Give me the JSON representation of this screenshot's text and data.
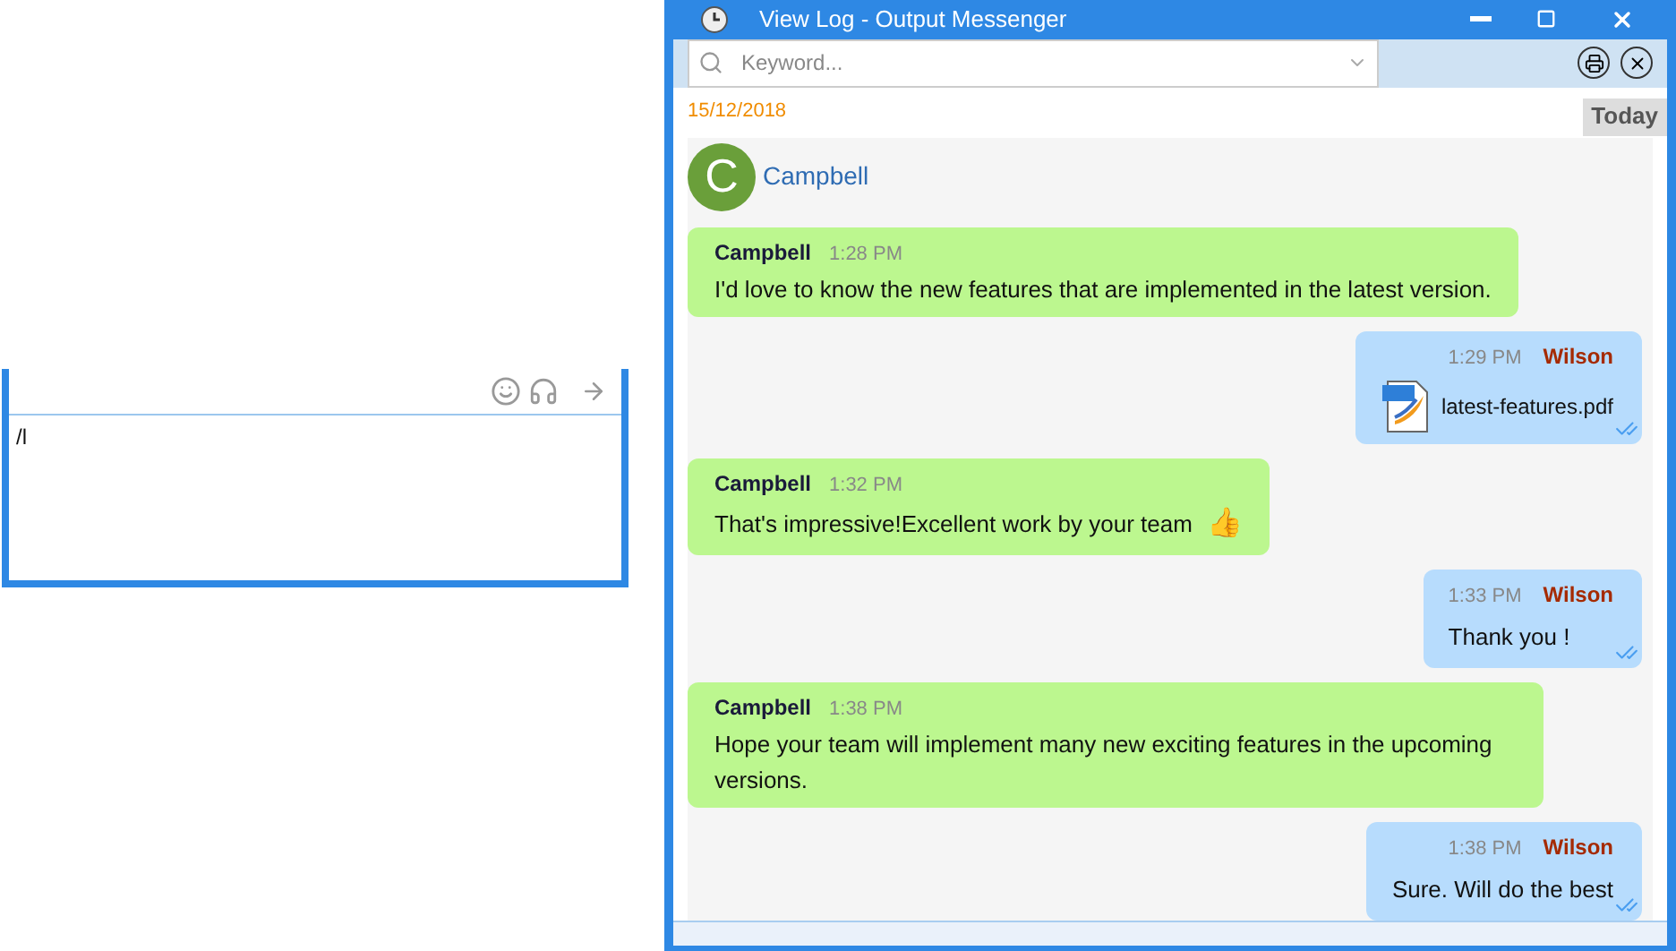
{
  "composer": {
    "value": "/l"
  },
  "window": {
    "title": "View Log - Output Messenger"
  },
  "search": {
    "placeholder": "Keyword..."
  },
  "date": "15/12/2018",
  "today_button": "Today",
  "contact": {
    "initial": "C",
    "name": "Campbell"
  },
  "messages": [
    {
      "kind": "incoming",
      "sender": "Campbell",
      "time": "1:28 PM",
      "text": "I'd love to know the new features that are implemented in the latest version."
    },
    {
      "kind": "outgoing",
      "sender": "Wilson",
      "time": "1:29 PM",
      "attachment": "latest-features.pdf"
    },
    {
      "kind": "incoming",
      "sender": "Campbell",
      "time": "1:32 PM",
      "text": "That's impressive!Excellent work by your team",
      "emoji": "👍"
    },
    {
      "kind": "outgoing",
      "sender": "Wilson",
      "time": "1:33 PM",
      "text": "Thank you !"
    },
    {
      "kind": "incoming",
      "sender": "Campbell",
      "time": "1:38 PM",
      "text": "Hope your team will implement many new exciting features in the upcoming versions."
    },
    {
      "kind": "outgoing",
      "sender": "Wilson",
      "time": "1:38 PM",
      "text": "Sure. Will do the best"
    }
  ]
}
